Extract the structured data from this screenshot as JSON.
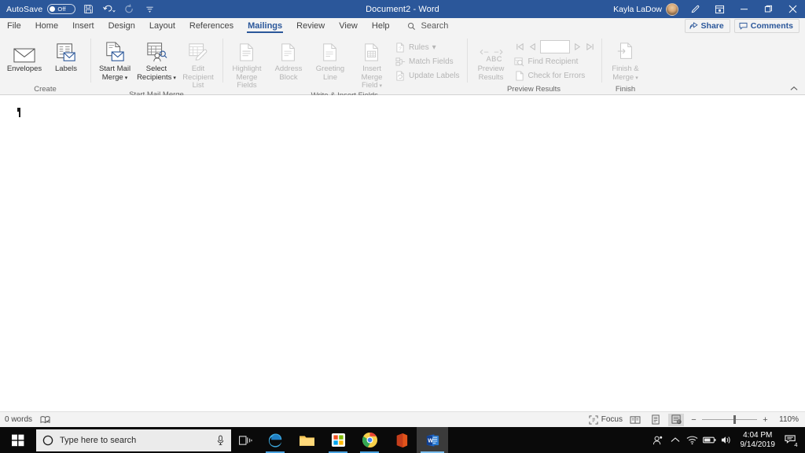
{
  "titlebar": {
    "autosave_label": "AutoSave",
    "autosave_state": "Off",
    "save_icon": "save-icon",
    "undo_icon": "undo-icon",
    "redo_icon": "redo-icon",
    "customize_qat_icon": "customize-quick-access-toolbar-icon",
    "document_title": "Document2  -  Word",
    "user_name": "Kayla LaDow",
    "avatar_name": "user-avatar",
    "pen_icon": "pen-icon",
    "ribbon_display_icon": "ribbon-display-options-icon",
    "minimize": "–",
    "maximize": "❐",
    "close": "✕"
  },
  "tabs": [
    {
      "label": "File",
      "active": false
    },
    {
      "label": "Home",
      "active": false
    },
    {
      "label": "Insert",
      "active": false
    },
    {
      "label": "Design",
      "active": false
    },
    {
      "label": "Layout",
      "active": false
    },
    {
      "label": "References",
      "active": false
    },
    {
      "label": "Mailings",
      "active": true
    },
    {
      "label": "Review",
      "active": false
    },
    {
      "label": "View",
      "active": false
    },
    {
      "label": "Help",
      "active": false
    }
  ],
  "search": {
    "placeholder": "Search",
    "icon": "search-icon"
  },
  "tabbar_right": {
    "share_label": "Share",
    "share_icon": "share-icon",
    "comments_label": "Comments",
    "comments_icon": "comment-icon"
  },
  "ribbon": {
    "collapse_icon": "collapse-ribbon-chevron-icon",
    "groups": [
      {
        "name": "Create",
        "label": "Create",
        "buttons": [
          {
            "label_line1": "Envelopes",
            "label_line2": "",
            "icon": "envelope-icon",
            "disabled": false,
            "dropdown": false
          },
          {
            "label_line1": "Labels",
            "label_line2": "",
            "icon": "labels-icon",
            "disabled": false,
            "dropdown": false
          }
        ]
      },
      {
        "name": "Start Mail Merge",
        "label": "Start Mail Merge",
        "buttons": [
          {
            "label_line1": "Start Mail",
            "label_line2": "Merge",
            "icon": "start-mail-merge-icon",
            "disabled": false,
            "dropdown": true
          },
          {
            "label_line1": "Select",
            "label_line2": "Recipients",
            "icon": "select-recipients-icon",
            "disabled": false,
            "dropdown": true
          },
          {
            "label_line1": "Edit",
            "label_line2": "Recipient List",
            "icon": "edit-recipient-list-icon",
            "disabled": true,
            "dropdown": false
          }
        ]
      },
      {
        "name": "Write & Insert Fields",
        "label": "Write & Insert Fields",
        "buttons": [
          {
            "label_line1": "Highlight",
            "label_line2": "Merge Fields",
            "icon": "highlight-merge-fields-icon",
            "disabled": true,
            "dropdown": false
          },
          {
            "label_line1": "Address",
            "label_line2": "Block",
            "icon": "address-block-icon",
            "disabled": true,
            "dropdown": false
          },
          {
            "label_line1": "Greeting",
            "label_line2": "Line",
            "icon": "greeting-line-icon",
            "disabled": true,
            "dropdown": false
          },
          {
            "label_line1": "Insert Merge",
            "label_line2": "Field",
            "icon": "insert-merge-field-icon",
            "disabled": true,
            "dropdown": true
          }
        ],
        "small_buttons": [
          {
            "label": "Rules",
            "icon": "rules-icon",
            "disabled": true,
            "dropdown": true
          },
          {
            "label": "Match Fields",
            "icon": "match-fields-icon",
            "disabled": true,
            "dropdown": false
          },
          {
            "label": "Update Labels",
            "icon": "update-labels-icon",
            "disabled": true,
            "dropdown": false
          }
        ]
      },
      {
        "name": "Preview Results",
        "label": "Preview Results",
        "buttons": [
          {
            "label_line1": "Preview",
            "label_line2": "Results",
            "icon": "preview-results-abc-icon",
            "disabled": true,
            "dropdown": false
          }
        ],
        "record_nav": {
          "first_icon": "first-record-icon",
          "prev_icon": "previous-record-icon",
          "record_value": "",
          "next_icon": "next-record-icon",
          "last_icon": "last-record-icon"
        },
        "small_buttons": [
          {
            "label": "Find Recipient",
            "icon": "find-recipient-icon",
            "disabled": true,
            "dropdown": false
          },
          {
            "label": "Check for Errors",
            "icon": "check-for-errors-icon",
            "disabled": true,
            "dropdown": false
          }
        ]
      },
      {
        "name": "Finish",
        "label": "Finish",
        "buttons": [
          {
            "label_line1": "Finish &",
            "label_line2": "Merge",
            "icon": "finish-and-merge-icon",
            "disabled": true,
            "dropdown": true
          }
        ]
      }
    ]
  },
  "document": {
    "caret": "text-cursor",
    "content": ""
  },
  "statusbar": {
    "word_count": "0 words",
    "proofing_icon": "proofing-errors-icon",
    "focus_label": "Focus",
    "focus_icon": "focus-mode-icon",
    "views": [
      {
        "name": "read-mode",
        "icon": "read-mode-icon",
        "active": false
      },
      {
        "name": "print-layout",
        "icon": "print-layout-icon",
        "active": false
      },
      {
        "name": "web-layout",
        "icon": "web-layout-icon",
        "active": true
      }
    ],
    "zoom_out": "−",
    "zoom_in": "+",
    "zoom_level": "110%"
  },
  "taskbar": {
    "start_icon": "windows-start-icon",
    "cortana_icon": "cortana-circle-icon",
    "search_placeholder": "Type here to search",
    "mic_icon": "microphone-icon",
    "taskview_icon": "task-view-icon",
    "apps": [
      {
        "name": "microsoft-edge",
        "icon": "edge-icon",
        "running": true,
        "active": false
      },
      {
        "name": "file-explorer",
        "icon": "file-explorer-icon",
        "running": false,
        "active": false
      },
      {
        "name": "microsoft-store",
        "icon": "microsoft-store-icon",
        "running": true,
        "active": false
      },
      {
        "name": "google-chrome",
        "icon": "chrome-icon",
        "running": true,
        "active": false
      },
      {
        "name": "microsoft-office",
        "icon": "office-icon",
        "running": false,
        "active": false
      },
      {
        "name": "microsoft-word",
        "icon": "word-icon",
        "running": true,
        "active": true
      }
    ],
    "tray": [
      {
        "name": "people-icon"
      },
      {
        "name": "show-hidden-icons-chevron"
      },
      {
        "name": "wifi-icon"
      },
      {
        "name": "battery-icon"
      },
      {
        "name": "volume-icon"
      }
    ],
    "time": "4:04 PM",
    "date": "9/14/2019",
    "notification_icon": "action-center-icon",
    "notification_count": "4"
  },
  "colors": {
    "word_blue": "#2b579a",
    "ribbon_bg": "#f3f3f3",
    "accent_link": "#2b579a",
    "taskbar_bg": "#0a0a0a"
  }
}
